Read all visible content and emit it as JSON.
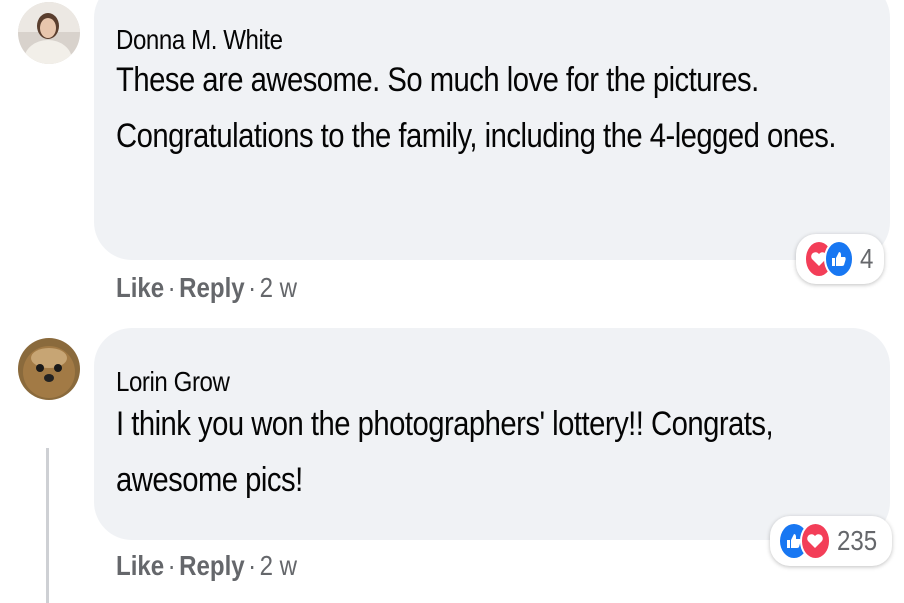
{
  "comments": [
    {
      "author": "Donna M. White",
      "text": "These are awesome. So much love for the pictures. Congratulations to the family, including the 4-legged ones.",
      "actions": {
        "like": "Like",
        "reply": "Reply",
        "time": "2 w"
      },
      "reactions": {
        "icons": [
          "heart-icon",
          "like-icon"
        ],
        "count": "4"
      }
    },
    {
      "author": "Lorin Grow",
      "text": "I think you won the photographers' lottery!! Congrats, awesome pics!",
      "actions": {
        "like": "Like",
        "reply": "Reply",
        "time": "2 w"
      },
      "reactions": {
        "icons": [
          "like-icon",
          "heart-icon"
        ],
        "count": "235"
      }
    }
  ],
  "separator": "·",
  "colors": {
    "bubble": "#f0f2f5",
    "like": "#1877f2",
    "love": "#f33e58",
    "meta": "#65676b"
  }
}
